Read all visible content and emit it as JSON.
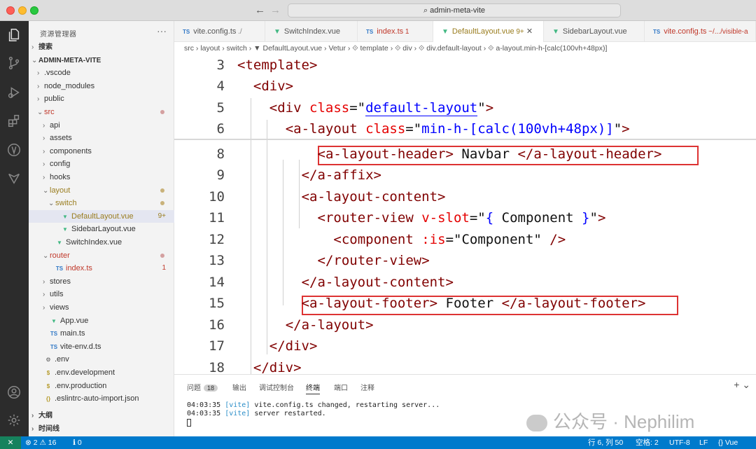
{
  "titlebar": {
    "search": "⌕ admin-meta-vite",
    "back": "←",
    "forward": "→"
  },
  "activity": [
    "files-icon",
    "source-control-icon",
    "run-debug-icon",
    "extensions-icon",
    "vetur-icon",
    "git-graph-icon",
    "account-icon",
    "settings-icon"
  ],
  "sidebar": {
    "title": "资源管理器",
    "more": "···",
    "rows": [
      {
        "label": "搜索",
        "indent": 0,
        "arrow": "›",
        "kind": "section",
        "bold": true
      },
      {
        "label": "ADMIN-META-VITE",
        "indent": 0,
        "arrow": "⌄",
        "kind": "root",
        "bold": true
      },
      {
        "label": ".vscode",
        "indent": 1,
        "arrow": "›",
        "kind": "folder"
      },
      {
        "label": "node_modules",
        "indent": 1,
        "arrow": "›",
        "kind": "folder"
      },
      {
        "label": "public",
        "indent": 1,
        "arrow": "›",
        "kind": "folder"
      },
      {
        "label": "src",
        "indent": 1,
        "arrow": "⌄",
        "kind": "folder",
        "color": "#c0392b",
        "dot": "red"
      },
      {
        "label": "api",
        "indent": 2,
        "arrow": "›",
        "kind": "folder"
      },
      {
        "label": "assets",
        "indent": 2,
        "arrow": "›",
        "kind": "folder"
      },
      {
        "label": "components",
        "indent": 2,
        "arrow": "›",
        "kind": "folder"
      },
      {
        "label": "config",
        "indent": 2,
        "arrow": "›",
        "kind": "folder"
      },
      {
        "label": "hooks",
        "indent": 2,
        "arrow": "›",
        "kind": "folder"
      },
      {
        "label": "layout",
        "indent": 2,
        "arrow": "⌄",
        "kind": "folder",
        "color": "#9a7d1f",
        "dot": "gold"
      },
      {
        "label": "switch",
        "indent": 3,
        "arrow": "⌄",
        "kind": "folder",
        "color": "#9a7d1f",
        "dot": "gold"
      },
      {
        "label": "DefaultLayout.vue",
        "indent": 4,
        "arrow": "",
        "kind": "vue",
        "color": "#9a7d1f",
        "badge": "9+",
        "selected": true
      },
      {
        "label": "SidebarLayout.vue",
        "indent": 4,
        "arrow": "",
        "kind": "vue"
      },
      {
        "label": "SwitchIndex.vue",
        "indent": 3,
        "arrow": "",
        "kind": "vue"
      },
      {
        "label": "router",
        "indent": 2,
        "arrow": "⌄",
        "kind": "folder",
        "color": "#c0392b",
        "dot": "red"
      },
      {
        "label": "index.ts",
        "indent": 3,
        "arrow": "",
        "kind": "ts",
        "color": "#c0392b",
        "badge": "1"
      },
      {
        "label": "stores",
        "indent": 2,
        "arrow": "›",
        "kind": "folder"
      },
      {
        "label": "utils",
        "indent": 2,
        "arrow": "›",
        "kind": "folder"
      },
      {
        "label": "views",
        "indent": 2,
        "arrow": "›",
        "kind": "folder"
      },
      {
        "label": "App.vue",
        "indent": 2,
        "arrow": "",
        "kind": "vue"
      },
      {
        "label": "main.ts",
        "indent": 2,
        "arrow": "",
        "kind": "ts"
      },
      {
        "label": "vite-env.d.ts",
        "indent": 2,
        "arrow": "",
        "kind": "ts"
      },
      {
        "label": ".env",
        "indent": 1,
        "arrow": "",
        "kind": "gear"
      },
      {
        "label": ".env.development",
        "indent": 1,
        "arrow": "",
        "kind": "dollar"
      },
      {
        "label": ".env.production",
        "indent": 1,
        "arrow": "",
        "kind": "dollar"
      },
      {
        "label": ".eslintrc-auto-import.json",
        "indent": 1,
        "arrow": "",
        "kind": "json"
      }
    ],
    "outline": "大纲",
    "timeline": "时间线"
  },
  "tabs": [
    {
      "label": "vite.config.ts",
      "suffix": "./",
      "kind": "ts"
    },
    {
      "label": "SwitchIndex.vue",
      "kind": "vue"
    },
    {
      "label": "index.ts",
      "suffix": "1",
      "kind": "ts",
      "color": "#c0392b"
    },
    {
      "label": "DefaultLayout.vue",
      "suffix": "9+",
      "kind": "vue",
      "active": true,
      "close": "✕",
      "color": "#9a7d1f"
    },
    {
      "label": "SidebarLayout.vue",
      "kind": "vue"
    },
    {
      "label": "vite.config.ts",
      "suffix": "~/.../visible-a",
      "kind": "ts",
      "color": "#c0392b"
    }
  ],
  "breadcrumb": "src › layout › switch › ▼ DefaultLayout.vue › Vetur › ⟐ template › ⟐ div › ⟐ div.default-layout › ⟐ a-layout.min-h-[calc(100vh+48px)]",
  "editor": {
    "lines": [
      {
        "n": "3",
        "tokens": [
          [
            "tag",
            "<template>"
          ]
        ],
        "indent": 0
      },
      {
        "n": "4",
        "tokens": [
          [
            "tag",
            "<div>"
          ]
        ],
        "indent": 1
      },
      {
        "n": "5",
        "tokens": [
          [
            "tag",
            "<div "
          ],
          [
            "attr",
            "class"
          ],
          [
            "txt",
            "=\""
          ],
          [
            "str",
            "default-layout"
          ],
          [
            "txt",
            "\""
          ],
          [
            "tag",
            ">"
          ]
        ],
        "indent": 2
      },
      {
        "n": "6",
        "tokens": [
          [
            "tag",
            "<a-layout "
          ],
          [
            "attr",
            "class"
          ],
          [
            "txt",
            "=\""
          ],
          [
            "str",
            "min-h-[calc(100vh+48px)]"
          ],
          [
            "txt",
            "\""
          ],
          [
            "tag",
            ">"
          ]
        ],
        "indent": 3
      },
      {
        "n": "8",
        "tokens": [
          [
            "tag",
            "<a-layout-header>"
          ],
          [
            "txt",
            " Navbar "
          ],
          [
            "tag",
            "</a-layout-header>"
          ]
        ],
        "indent": 5
      },
      {
        "n": "9",
        "tokens": [
          [
            "tag",
            "</a-affix>"
          ]
        ],
        "indent": 4
      },
      {
        "n": "10",
        "tokens": [
          [
            "tag",
            "<a-layout-content>"
          ]
        ],
        "indent": 4
      },
      {
        "n": "11",
        "tokens": [
          [
            "tag",
            "<router-view "
          ],
          [
            "attr",
            "v-slot"
          ],
          [
            "txt",
            "=\""
          ],
          [
            "str",
            "{"
          ],
          [
            "txt",
            " Component "
          ],
          [
            "str",
            "}"
          ],
          [
            "txt",
            "\""
          ],
          [
            "tag",
            ">"
          ]
        ],
        "indent": 5
      },
      {
        "n": "12",
        "tokens": [
          [
            "tag",
            "<component "
          ],
          [
            "attr",
            ":is"
          ],
          [
            "txt",
            "=\"Component\" "
          ],
          [
            "tag",
            "/>"
          ]
        ],
        "indent": 6
      },
      {
        "n": "13",
        "tokens": [
          [
            "tag",
            "</router-view>"
          ]
        ],
        "indent": 5
      },
      {
        "n": "14",
        "tokens": [
          [
            "tag",
            "</a-layout-content>"
          ]
        ],
        "indent": 4
      },
      {
        "n": "15",
        "tokens": [
          [
            "tag",
            "<a-layout-footer>"
          ],
          [
            "txt",
            " Footer "
          ],
          [
            "tag",
            "</a-layout-footer>"
          ]
        ],
        "indent": 4
      },
      {
        "n": "16",
        "tokens": [
          [
            "tag",
            "</a-layout>"
          ]
        ],
        "indent": 3
      },
      {
        "n": "17",
        "tokens": [
          [
            "tag",
            "</div>"
          ]
        ],
        "indent": 2
      },
      {
        "n": "18",
        "tokens": [
          [
            "tag",
            "</div>"
          ]
        ],
        "indent": 1
      }
    ]
  },
  "panel": {
    "tabs": [
      {
        "label": "问题",
        "badge": "18"
      },
      {
        "label": "输出"
      },
      {
        "label": "调试控制台"
      },
      {
        "label": "终端",
        "active": true
      },
      {
        "label": "端口"
      },
      {
        "label": "注释"
      }
    ],
    "plus": "+ ⌄",
    "term_lines": [
      {
        "time": "04:03:35",
        "tag": "[vite]",
        "msg": " vite.config.ts changed, restarting server..."
      },
      {
        "time": "04:03:35",
        "tag": "[vite]",
        "msg": " server restarted."
      }
    ]
  },
  "watermark": "公众号 · Nephilim",
  "status": {
    "remote": "✕",
    "problems": "⊗ 2 ⚠ 16",
    "ports": "ℹ 0",
    "position": "行 6, 列 50",
    "spaces": "空格: 2",
    "encoding": "UTF-8",
    "eol": "LF",
    "lang": "{} Vue"
  }
}
